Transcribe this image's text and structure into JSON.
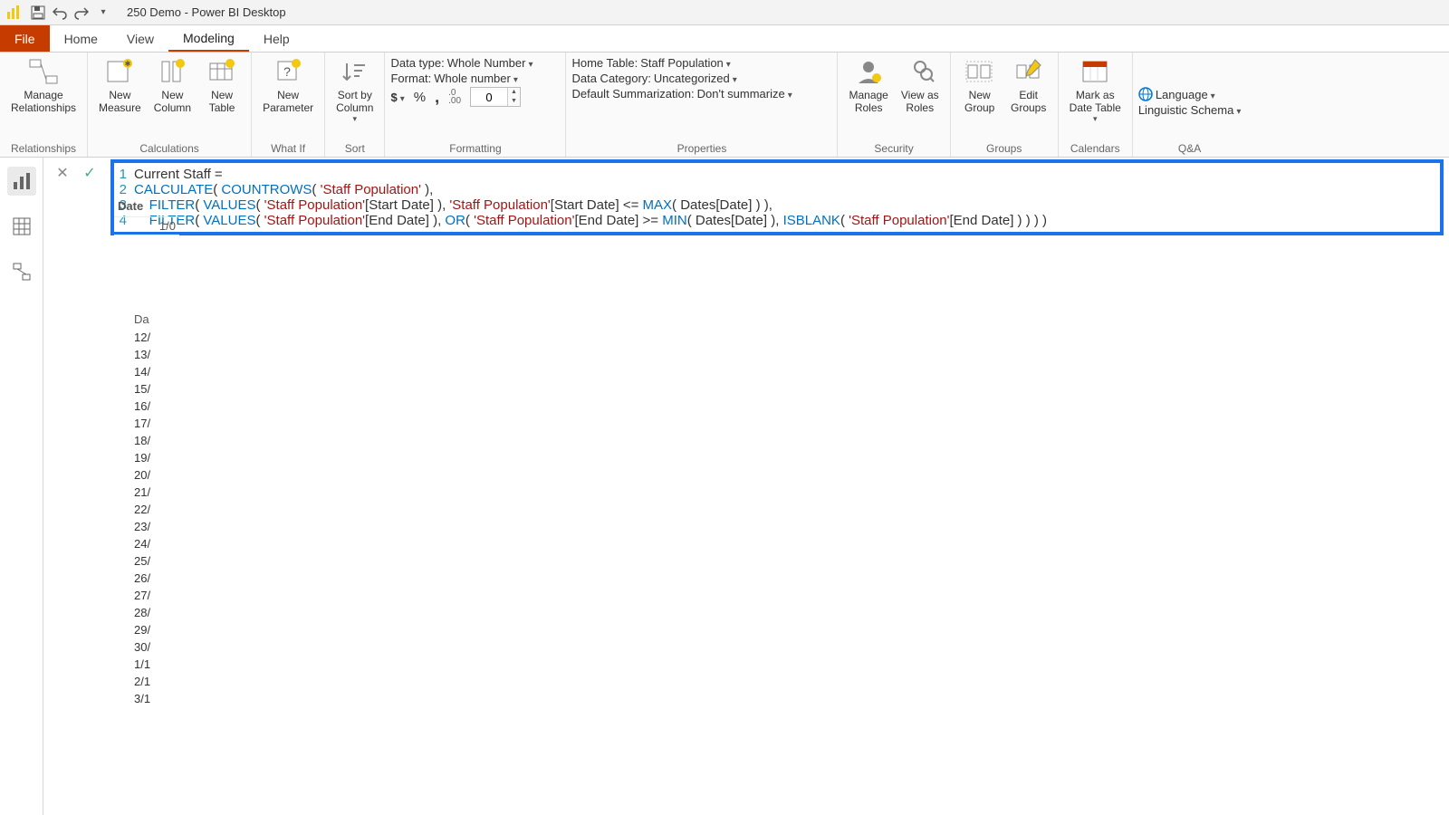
{
  "titlebar": {
    "title": "250 Demo - Power BI Desktop"
  },
  "menutabs": {
    "file": "File",
    "home": "Home",
    "view": "View",
    "modeling": "Modeling",
    "help": "Help"
  },
  "ribbon": {
    "relationships": {
      "manage": "Manage\nRelationships",
      "group": "Relationships"
    },
    "calculations": {
      "measure": "New\nMeasure",
      "column": "New\nColumn",
      "table": "New\nTable",
      "group": "Calculations"
    },
    "whatif": {
      "param": "New\nParameter",
      "group": "What If"
    },
    "sort": {
      "sortby": "Sort by\nColumn",
      "group": "Sort"
    },
    "formatting": {
      "datatype_label": "Data type:",
      "datatype_value": "Whole Number",
      "format_label": "Format:",
      "format_value": "Whole number",
      "currency": "$",
      "percent": "%",
      "comma": ",",
      "decimal_icon": ".0 .00",
      "decimals": "0",
      "group": "Formatting"
    },
    "properties": {
      "hometable_label": "Home Table:",
      "hometable_value": "Staff Population",
      "datacat_label": "Data Category:",
      "datacat_value": "Uncategorized",
      "summ_label": "Default Summarization:",
      "summ_value": "Don't summarize",
      "group": "Properties"
    },
    "security": {
      "manage": "Manage\nRoles",
      "viewas": "View as\nRoles",
      "group": "Security"
    },
    "groups": {
      "new": "New\nGroup",
      "edit": "Edit\nGroups",
      "group": "Groups"
    },
    "calendars": {
      "mark": "Mark as\nDate Table",
      "group": "Calendars"
    },
    "qa": {
      "lang": "Language",
      "schema": "Linguistic Schema",
      "group": "Q&A"
    }
  },
  "formula": {
    "ln1": "1",
    "ln2": "2",
    "ln3": "3",
    "ln4": "4",
    "l1_a": "Current Staff = ",
    "l2_calc": "CALCULATE",
    "l2_p1": "( ",
    "l2_count": "COUNTROWS",
    "l2_rest": "( ",
    "l2_str": "'Staff Population'",
    "l2_end": " ),",
    "l3_indent": "    ",
    "l3_filter": "FILTER",
    "l3_p": "( ",
    "l3_values": "VALUES",
    "l3_p2": "( ",
    "l3_str": "'Staff Population'",
    "l3_col": "[Start Date] ), ",
    "l3_str2": "'Staff Population'",
    "l3_col2": "[Start Date] <= ",
    "l3_max": "MAX",
    "l3_p3": "( Dates[Date] ) ),",
    "l4_indent": "    ",
    "l4_filter": "FILTER",
    "l4_p": "( ",
    "l4_values": "VALUES",
    "l4_p2": "( ",
    "l4_str": "'Staff Population'",
    "l4_col": "[End Date] ), ",
    "l4_or": "OR",
    "l4_p3": "( ",
    "l4_str2": "'Staff Population'",
    "l4_col2": "[End Date] >= ",
    "l4_min": "MIN",
    "l4_p4": "( Dates[Date] ), ",
    "l4_isblank": "ISBLANK",
    "l4_p5": "( ",
    "l4_str3": "'Staff Population'",
    "l4_col3": "[End Date] ) ) ) )"
  },
  "datapeek": {
    "header": "Date",
    "row1": "1/0"
  },
  "datelist": {
    "header": "Da",
    "rows": [
      "12/",
      "13/",
      "14/",
      "15/",
      "16/",
      "17/",
      "18/",
      "19/",
      "20/",
      "21/",
      "22/",
      "23/",
      "24/",
      "25/",
      "26/",
      "27/",
      "28/",
      "29/",
      "30/",
      "1/1",
      "2/1",
      "3/1"
    ]
  }
}
